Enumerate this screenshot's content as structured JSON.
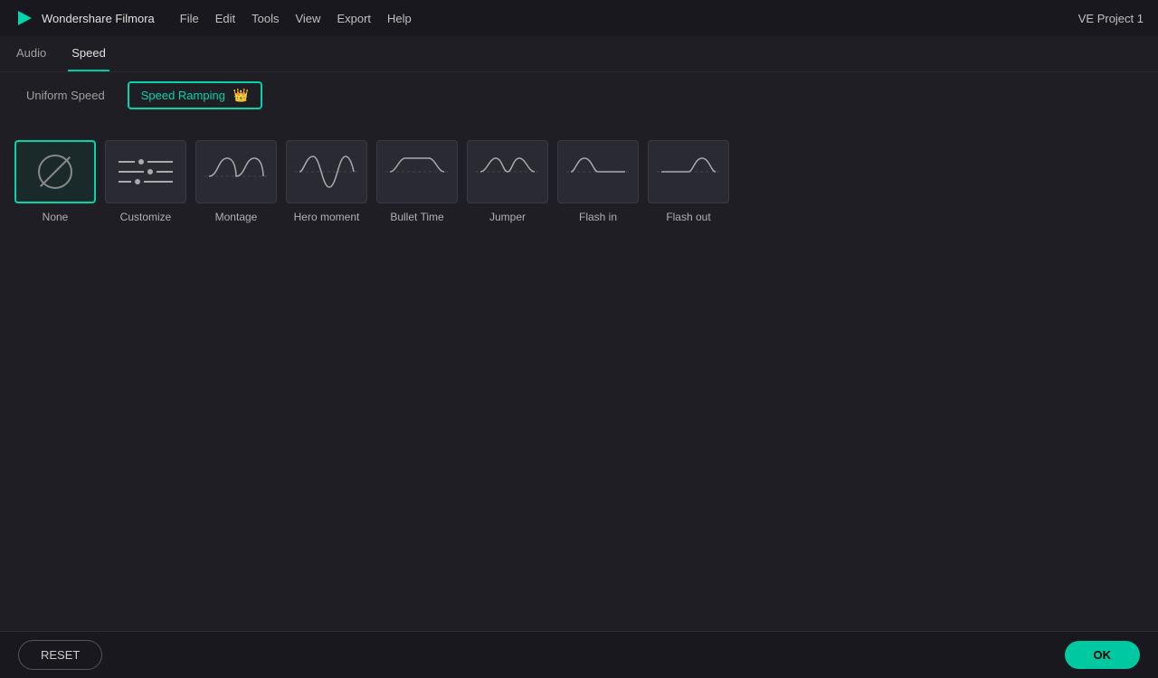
{
  "app": {
    "logo_symbol": "▶",
    "name": "Wondershare Filmora",
    "menu_items": [
      "File",
      "Edit",
      "Tools",
      "View",
      "Export",
      "Help"
    ],
    "project_title": "VE Project 1"
  },
  "tabs": [
    {
      "id": "audio",
      "label": "Audio",
      "active": false
    },
    {
      "id": "speed",
      "label": "Speed",
      "active": true
    }
  ],
  "subtabs": [
    {
      "id": "uniform",
      "label": "Uniform Speed",
      "active": false,
      "crown": false
    },
    {
      "id": "ramping",
      "label": "Speed Ramping",
      "active": true,
      "crown": true
    }
  ],
  "presets": [
    {
      "id": "none",
      "label": "None",
      "type": "none",
      "selected": true
    },
    {
      "id": "customize",
      "label": "Customize",
      "type": "customize",
      "selected": false
    },
    {
      "id": "montage",
      "label": "Montage",
      "type": "montage",
      "selected": false
    },
    {
      "id": "hero_moment",
      "label": "Hero moment",
      "type": "hero_moment",
      "selected": false
    },
    {
      "id": "bullet_time",
      "label": "Bullet Time",
      "type": "bullet_time",
      "selected": false
    },
    {
      "id": "jumper",
      "label": "Jumper",
      "type": "jumper",
      "selected": false
    },
    {
      "id": "flash_in",
      "label": "Flash in",
      "type": "flash_in",
      "selected": false
    },
    {
      "id": "flash_out",
      "label": "Flash out",
      "type": "flash_out",
      "selected": false
    }
  ],
  "buttons": {
    "reset": "RESET",
    "ok": "OK"
  },
  "colors": {
    "accent": "#00d4a8",
    "bg_dark": "#18181e",
    "bg_mid": "#1e1e24",
    "bg_card": "#2a2a33"
  }
}
